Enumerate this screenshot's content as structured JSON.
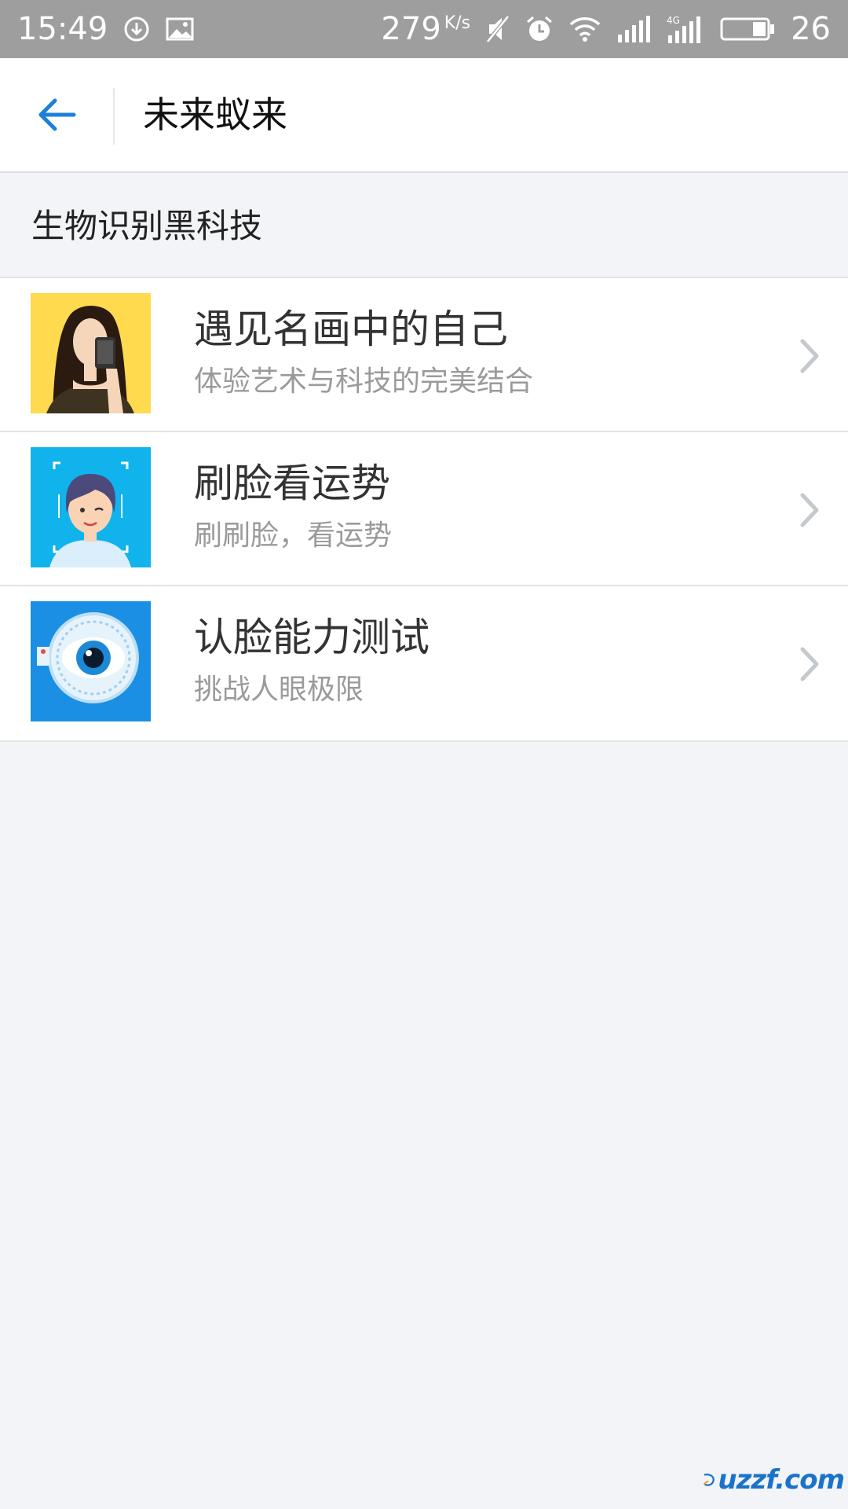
{
  "status_bar": {
    "time": "15:49",
    "speed_value": "279",
    "speed_unit": "K/s",
    "network": "4G",
    "battery_level": "26",
    "icons": [
      "download-icon",
      "image-icon",
      "mute-icon",
      "alarm-icon",
      "wifi-icon",
      "signal-icon",
      "signal-4g-icon",
      "battery-icon"
    ]
  },
  "header": {
    "title": "未来蚁来",
    "back_icon": "arrow-left-icon"
  },
  "section": {
    "label": "生物识别黑科技"
  },
  "items": [
    {
      "title": "遇见名画中的自己",
      "subtitle": "体验艺术与科技的完美结合",
      "icon": "portrait-painting-icon"
    },
    {
      "title": "刷脸看运势",
      "subtitle": "刷刷脸，看运势",
      "icon": "face-scan-girl-icon"
    },
    {
      "title": "认脸能力测试",
      "subtitle": "挑战人眼极限",
      "icon": "eye-scan-icon"
    }
  ],
  "watermark": {
    "text": "uzzf.com"
  },
  "colors": {
    "status_bar": "#9e9e9e",
    "accent_blue": "#1d7fd8",
    "page_bg": "#f2f4f7",
    "title_text": "#333333",
    "subtitle_text": "#9a9a9a"
  }
}
